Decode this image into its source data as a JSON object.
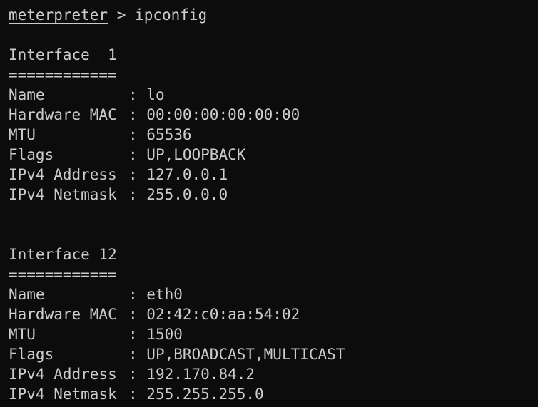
{
  "prompt": {
    "name": "meterpreter",
    "symbol": ">",
    "command": "ipconfig"
  },
  "interfaces": [
    {
      "title": "Interface  1",
      "underline": "============",
      "fields": [
        {
          "key": "Name",
          "value": "lo"
        },
        {
          "key": "Hardware MAC",
          "value": "00:00:00:00:00:00"
        },
        {
          "key": "MTU",
          "value": "65536"
        },
        {
          "key": "Flags",
          "value": "UP,LOOPBACK"
        },
        {
          "key": "IPv4 Address",
          "value": "127.0.0.1"
        },
        {
          "key": "IPv4 Netmask",
          "value": "255.0.0.0"
        }
      ]
    },
    {
      "title": "Interface 12",
      "underline": "============",
      "fields": [
        {
          "key": "Name",
          "value": "eth0"
        },
        {
          "key": "Hardware MAC",
          "value": "02:42:c0:aa:54:02"
        },
        {
          "key": "MTU",
          "value": "1500"
        },
        {
          "key": "Flags",
          "value": "UP,BROADCAST,MULTICAST"
        },
        {
          "key": "IPv4 Address",
          "value": "192.170.84.2"
        },
        {
          "key": "IPv4 Netmask",
          "value": "255.255.255.0"
        }
      ]
    }
  ],
  "colors": {
    "background": "#0c0c0c",
    "text": "#cccccc"
  }
}
